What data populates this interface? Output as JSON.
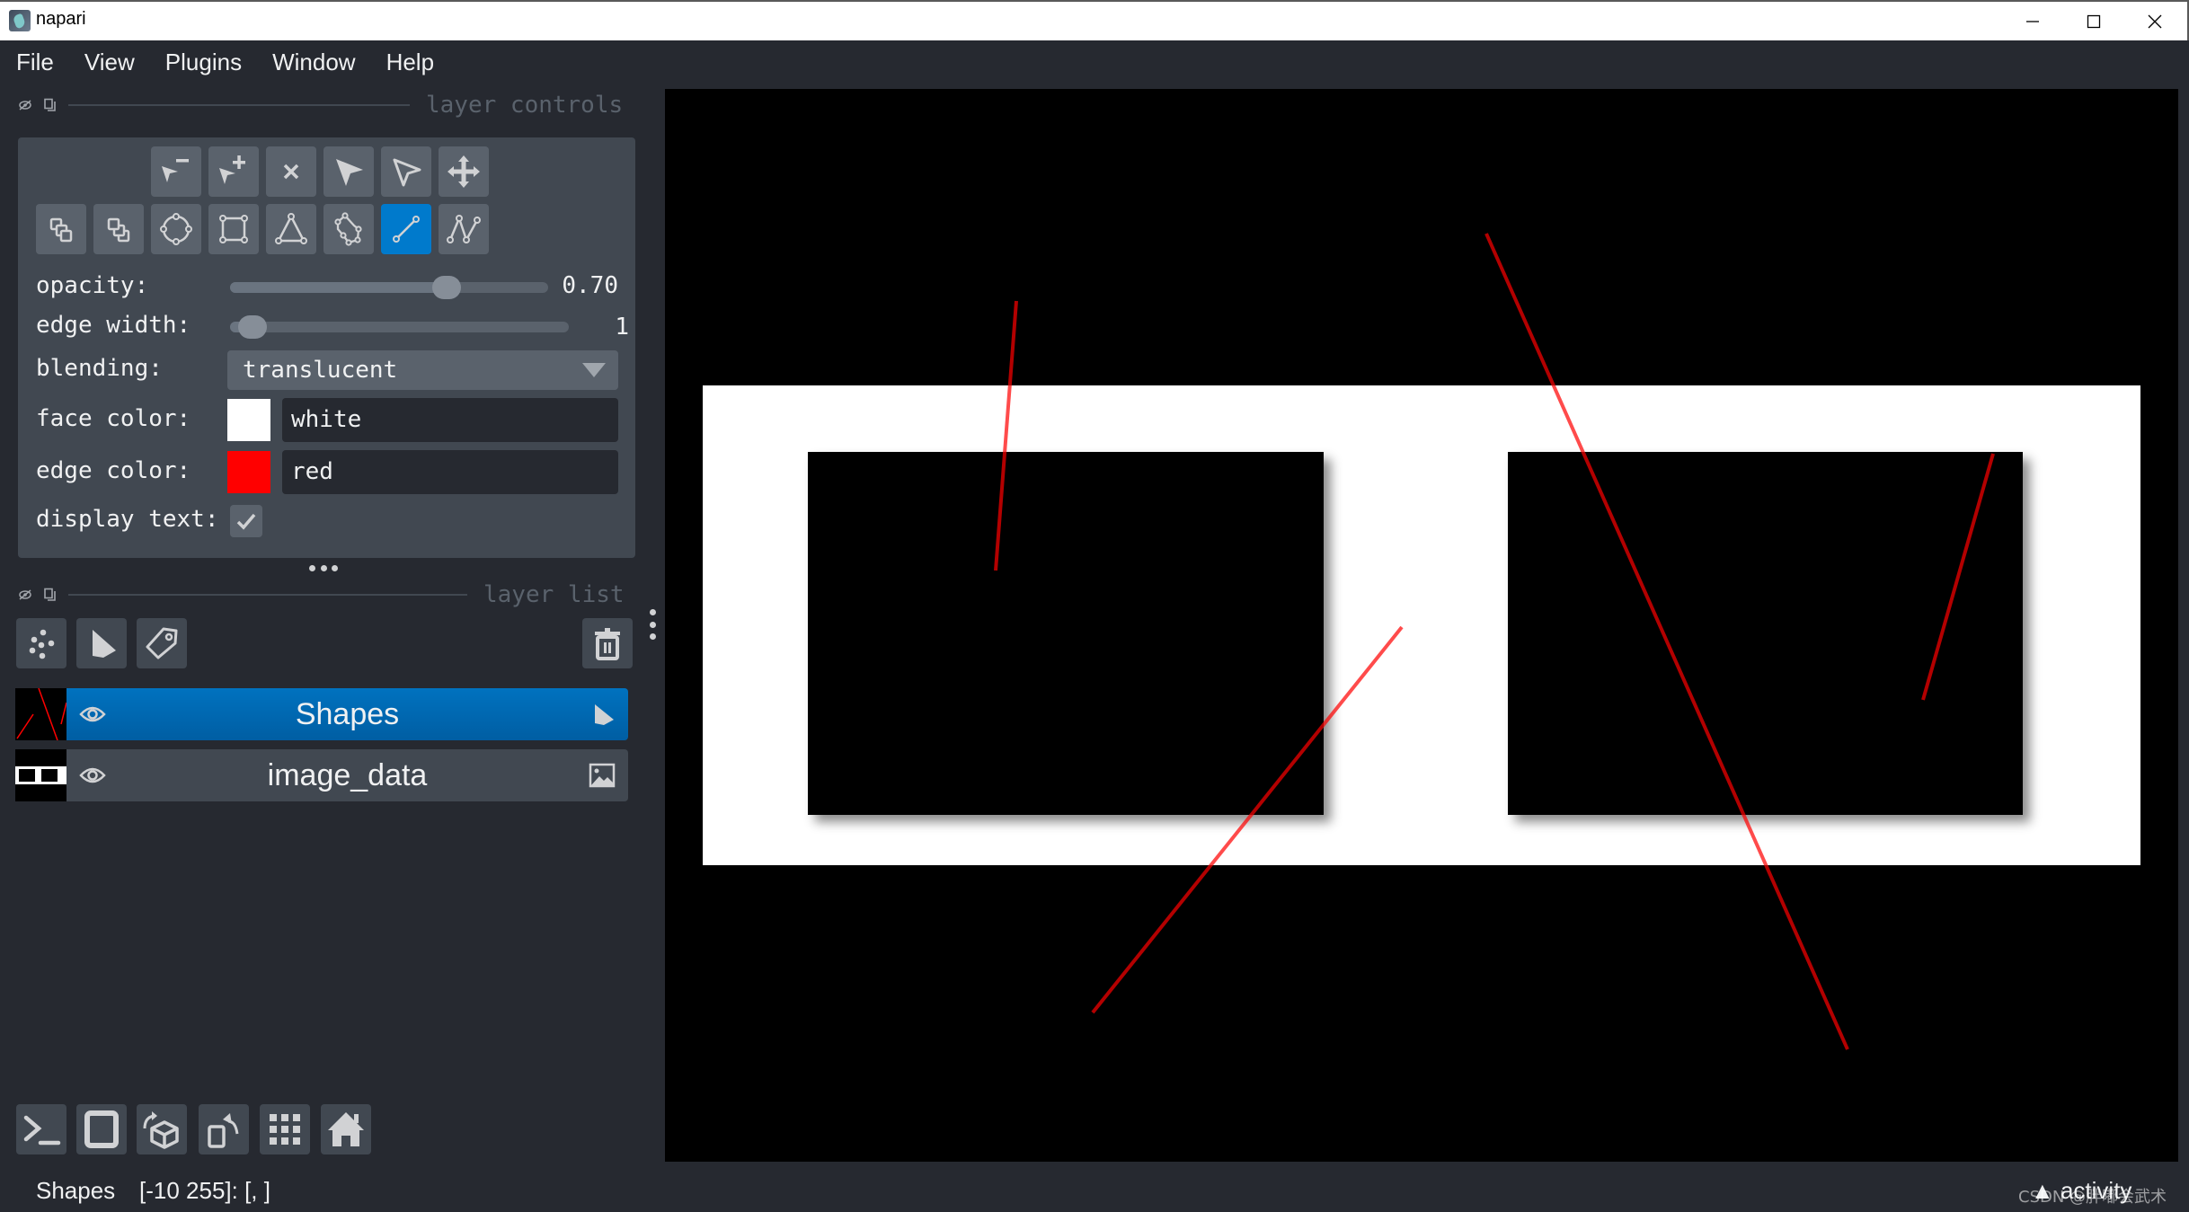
{
  "window": {
    "title": "napari",
    "minimize_icon": "minimize-icon",
    "maximize_icon": "maximize-icon",
    "close_icon": "close-icon"
  },
  "menu": [
    "File",
    "View",
    "Plugins",
    "Window",
    "Help"
  ],
  "layer_controls": {
    "header_title": "layer controls",
    "tools_row1": [
      {
        "name": "remove-vertex",
        "icon": "vertex-remove-icon"
      },
      {
        "name": "add-vertex",
        "icon": "vertex-insert-icon"
      },
      {
        "name": "delete-shape",
        "icon": "delete-shape-icon"
      },
      {
        "name": "select",
        "icon": "select-arrow-icon"
      },
      {
        "name": "direct-select",
        "icon": "direct-select-icon"
      },
      {
        "name": "pan-zoom",
        "icon": "pan-zoom-icon"
      }
    ],
    "tools_row2": [
      {
        "name": "move-back",
        "icon": "move-back-icon"
      },
      {
        "name": "move-front",
        "icon": "move-front-icon"
      },
      {
        "name": "add-ellipse",
        "icon": "ellipse-icon"
      },
      {
        "name": "add-rectangle",
        "icon": "rectangle-icon"
      },
      {
        "name": "add-polygon",
        "icon": "polygon-icon"
      },
      {
        "name": "add-path-polygon",
        "icon": "path-polygon-icon"
      },
      {
        "name": "add-line",
        "icon": "line-icon",
        "active": true
      },
      {
        "name": "add-path",
        "icon": "path-icon"
      }
    ],
    "opacity": {
      "label": "opacity:",
      "value": 0.7,
      "display": "0.70"
    },
    "edge_width": {
      "label": "edge width:",
      "value": 1,
      "min": 0,
      "max": 40,
      "display": "1"
    },
    "blending": {
      "label": "blending:",
      "value": "translucent"
    },
    "face_color": {
      "label": "face color:",
      "value": "white",
      "swatch": "#ffffff"
    },
    "edge_color": {
      "label": "edge color:",
      "value": "red",
      "swatch": "#ff0000"
    },
    "display_text": {
      "label": "display text:",
      "checked": true
    }
  },
  "layer_list": {
    "header_title": "layer list",
    "buttons": [
      {
        "name": "new-points-layer",
        "icon": "points-icon"
      },
      {
        "name": "new-shapes-layer",
        "icon": "shapes-icon"
      },
      {
        "name": "new-labels-layer",
        "icon": "labels-tag-icon"
      }
    ],
    "delete_icon": "trash-icon",
    "layers": [
      {
        "name": "Shapes",
        "visible": true,
        "selected": true,
        "type_icon": "shapes-icon"
      },
      {
        "name": "image_data",
        "visible": true,
        "selected": false,
        "type_icon": "image-icon"
      }
    ]
  },
  "viewer_buttons": [
    {
      "name": "console",
      "icon": "console-icon"
    },
    {
      "name": "toggle-ndisplay",
      "icon": "square-2d-icon"
    },
    {
      "name": "roll-dimensions",
      "icon": "roll-cube-icon"
    },
    {
      "name": "transpose-dimensions",
      "icon": "transpose-icon"
    },
    {
      "name": "grid-view",
      "icon": "grid-icon"
    },
    {
      "name": "reset-view",
      "icon": "home-icon"
    }
  ],
  "status": {
    "layer": "Shapes",
    "coords": "[-10 255]: [, ]",
    "activity": "activity",
    "watermark": "CSDN @胖嘟会武术"
  },
  "canvas": {
    "background": "#000000",
    "image_data": {
      "background": "#000000",
      "band_color": "#ffffff",
      "box_color": "#000000"
    },
    "shapes": {
      "edge_color": "#ff0000",
      "opacity": 0.7,
      "count": 4,
      "type": "line"
    }
  },
  "colors": {
    "accent": "#007acc",
    "background": "#262930",
    "panel": "#414851",
    "button": "#5a626c",
    "text": "#f0f1f2"
  }
}
